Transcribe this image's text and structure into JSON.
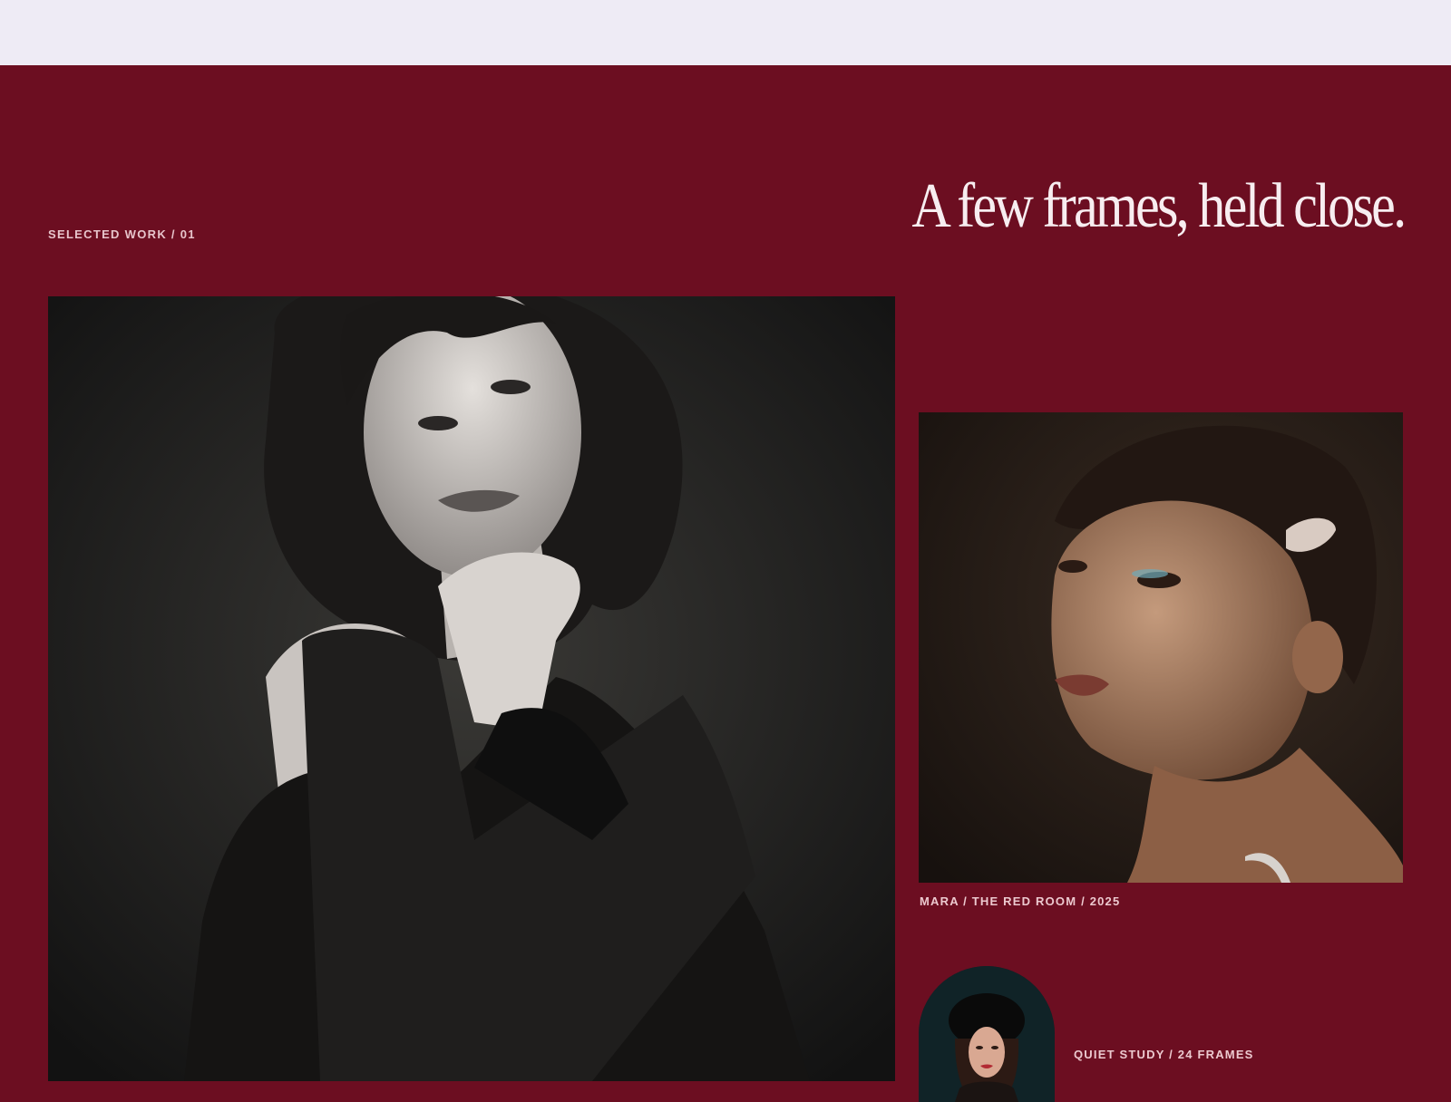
{
  "header": {
    "bar_color": "#eeebf5"
  },
  "section": {
    "background_color": "#6c0e21",
    "eyebrow": "SELECTED WORK / 01",
    "headline": "A few frames, held close."
  },
  "gallery": {
    "main_photo": {
      "icon": "portrait-photo",
      "style": "black-and-white portrait"
    },
    "side_photo": {
      "icon": "portrait-photo",
      "caption": "MARA / THE RED ROOM / 2025"
    },
    "study": {
      "icon": "portrait-thumbnail",
      "caption": "QUIET STUDY / 24 FRAMES"
    }
  }
}
